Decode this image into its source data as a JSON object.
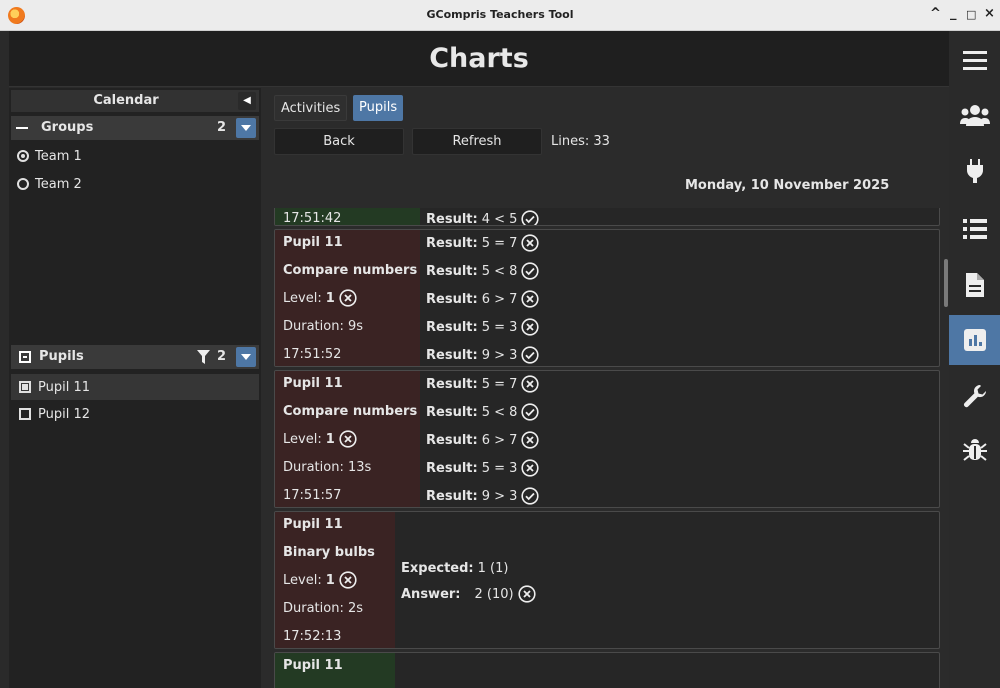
{
  "window": {
    "title": "GCompris Teachers Tool",
    "controls": [
      "^",
      "_",
      "□",
      "×"
    ]
  },
  "header": {
    "title": "Charts"
  },
  "nav": {
    "items": [
      {
        "name": "menu-icon"
      },
      {
        "name": "users-icon"
      },
      {
        "name": "plugin-icon"
      },
      {
        "name": "list-icon"
      },
      {
        "name": "document-icon"
      },
      {
        "name": "chart-icon",
        "active": true
      },
      {
        "name": "wrench-icon"
      },
      {
        "name": "bug-icon"
      }
    ]
  },
  "left": {
    "calendar_label": "Calendar",
    "groups": {
      "label": "Groups",
      "count": "2",
      "items": [
        {
          "label": "Team 1",
          "selected": true
        },
        {
          "label": "Team 2",
          "selected": false
        }
      ]
    },
    "pupils": {
      "label": "Pupils",
      "count": "2",
      "items": [
        {
          "label": "Pupil 11",
          "checked": true
        },
        {
          "label": "Pupil 12",
          "checked": false
        }
      ]
    }
  },
  "main": {
    "tabs": [
      {
        "label": "Activities",
        "active": false
      },
      {
        "label": "Pupils",
        "active": true
      }
    ],
    "back_label": "Back",
    "refresh_label": "Refresh",
    "lines_text": "Lines: 33",
    "date_text": "Monday, 10 November 2025",
    "partial_time": "17:51:42",
    "partial_result": {
      "label": "Result:",
      "value": "4 < 5",
      "ok": true
    },
    "cards": [
      {
        "pupil": "Pupil 11",
        "activity": "Compare numbers",
        "level_label": "Level:",
        "level": "1",
        "level_ok": false,
        "duration": "Duration: 9s",
        "time": "17:51:52",
        "results": [
          {
            "label": "Result:",
            "value": "5 = 7",
            "ok": false
          },
          {
            "label": "Result:",
            "value": "5 < 8",
            "ok": true
          },
          {
            "label": "Result:",
            "value": "6 > 7",
            "ok": false
          },
          {
            "label": "Result:",
            "value": "5 = 3",
            "ok": false
          },
          {
            "label": "Result:",
            "value": "9 > 3",
            "ok": true
          }
        ]
      },
      {
        "pupil": "Pupil 11",
        "activity": "Compare numbers",
        "level_label": "Level:",
        "level": "1",
        "level_ok": false,
        "duration": "Duration: 13s",
        "time": "17:51:57",
        "results": [
          {
            "label": "Result:",
            "value": "5 = 7",
            "ok": false
          },
          {
            "label": "Result:",
            "value": "5 < 8",
            "ok": true
          },
          {
            "label": "Result:",
            "value": "6 > 7",
            "ok": false
          },
          {
            "label": "Result:",
            "value": "5 = 3",
            "ok": false
          },
          {
            "label": "Result:",
            "value": "9 > 3",
            "ok": true
          }
        ]
      },
      {
        "pupil": "Pupil 11",
        "activity": "Binary bulbs",
        "level_label": "Level:",
        "level": "1",
        "level_ok": false,
        "duration": "Duration: 2s",
        "time": "17:52:13",
        "expected_label": "Expected:",
        "expected_value": "1 (1)",
        "answer_label": "Answer:",
        "answer_value": "2 (10)",
        "answer_ok": false
      },
      {
        "pupil": "Pupil 11"
      }
    ],
    "colors": {
      "fail_side": "#3a2323",
      "ok_side": "#233a23",
      "accent": "#4e77a5"
    }
  }
}
